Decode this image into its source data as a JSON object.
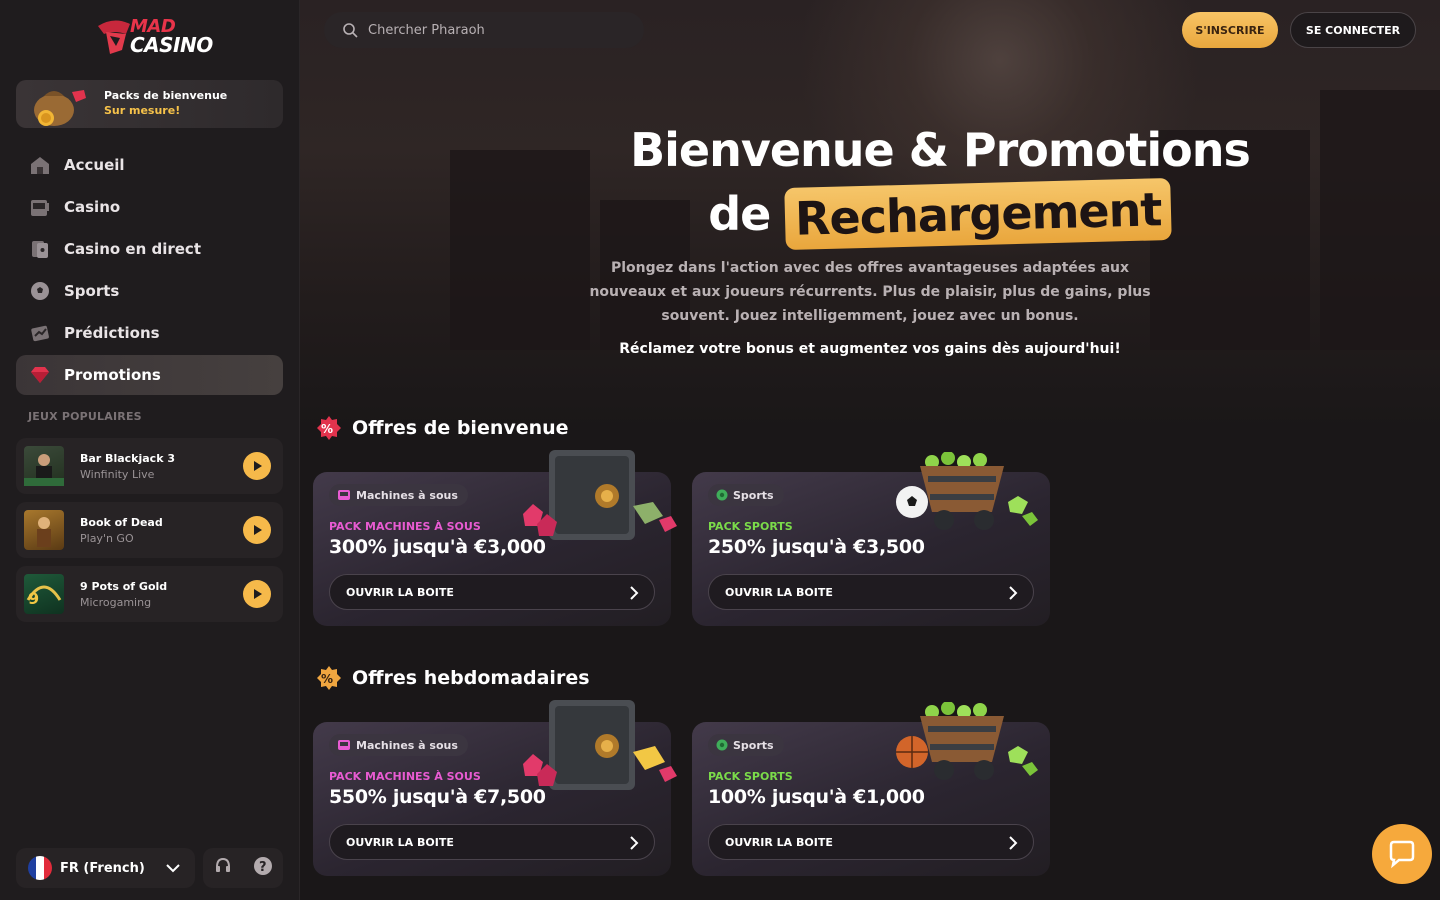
{
  "brand": {
    "line1": "MAD",
    "line2": "CASINO"
  },
  "welcome_pack": {
    "title": "Packs de bienvenue",
    "subtitle": "Sur mesure!"
  },
  "nav": [
    {
      "label": "Accueil",
      "icon": "home-icon"
    },
    {
      "label": "Casino",
      "icon": "slot-machine-icon"
    },
    {
      "label": "Casino en direct",
      "icon": "live-cards-icon"
    },
    {
      "label": "Sports",
      "icon": "soccer-ball-icon"
    },
    {
      "label": "Prédictions",
      "icon": "predictions-icon"
    },
    {
      "label": "Promotions",
      "icon": "diamond-icon",
      "active": true
    }
  ],
  "popular": {
    "label": "JEUX POPULAIRES",
    "games": [
      {
        "name": "Bar Blackjack 3",
        "provider": "Winfinity Live"
      },
      {
        "name": "Book of Dead",
        "provider": "Play'n GO"
      },
      {
        "name": "9 Pots of Gold",
        "provider": "Microgaming"
      }
    ]
  },
  "language": {
    "label": "FR (French)"
  },
  "search": {
    "placeholder": "Chercher Pharaoh"
  },
  "header": {
    "signup": "S'INSCRIRE",
    "login": "SE CONNECTER"
  },
  "hero": {
    "title_line1": "Bienvenue & Promotions",
    "title_line2_prefix": "de",
    "title_line2_highlight": "Rechargement",
    "description": "Plongez dans l'action avec des offres avantageuses adaptées aux nouveaux et aux joueurs récurrents. Plus de plaisir, plus de gains, plus souvent. Jouez intelligemment, jouez avec un bonus.",
    "claim": "Réclamez votre bonus et augmentez vos gains dès aujourd'hui!"
  },
  "sections": [
    {
      "title": "Offres de bienvenue",
      "cards": [
        {
          "chip": "Machines à sous",
          "pack": "PACK MACHINES À SOUS",
          "amount": "300% jusqu'à €3,000",
          "button": "OUVRIR LA BOITE",
          "kind": "slots",
          "pack_color": "#e85bd2"
        },
        {
          "chip": "Sports",
          "pack": "PACK SPORTS",
          "amount": "250% jusqu'à €3,500",
          "button": "OUVRIR LA BOITE",
          "kind": "sports",
          "pack_color": "#7bdc4a"
        }
      ]
    },
    {
      "title": "Offres hebdomadaires",
      "cards": [
        {
          "chip": "Machines à sous",
          "pack": "PACK MACHINES À SOUS",
          "amount": "550% jusqu'à €7,500",
          "button": "OUVRIR LA BOITE",
          "kind": "slots",
          "pack_color": "#e85bd2"
        },
        {
          "chip": "Sports",
          "pack": "PACK SPORTS",
          "amount": "100% jusqu'à €1,000",
          "button": "OUVRIR LA BOITE",
          "kind": "sports",
          "pack_color": "#7bdc4a"
        }
      ]
    }
  ],
  "colors": {
    "accent": "#f6b94a",
    "slots": "#e85bd2",
    "sports": "#7bdc4a"
  }
}
